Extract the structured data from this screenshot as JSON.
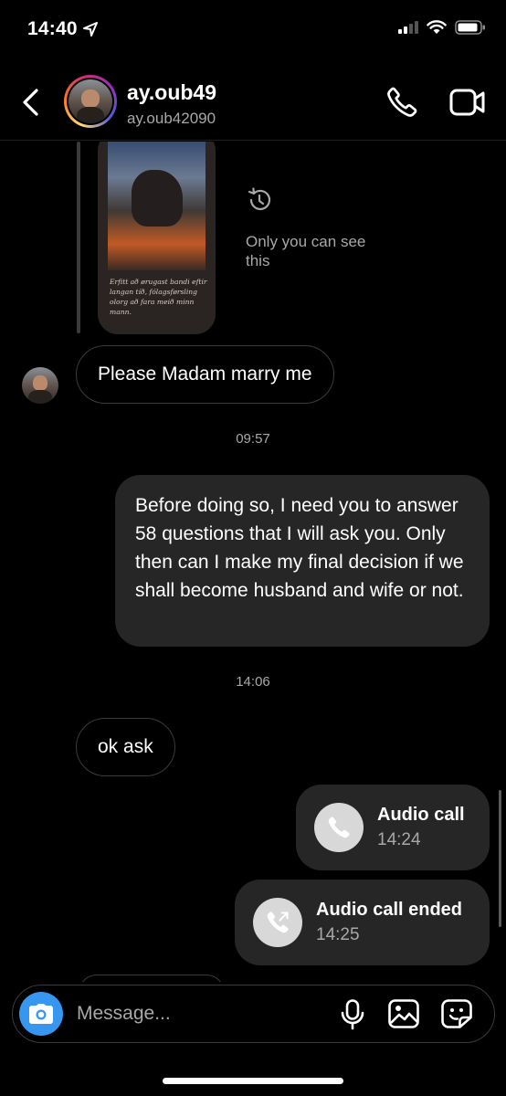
{
  "status_bar": {
    "time": "14:40"
  },
  "header": {
    "username": "ay.oub49",
    "subname": "ay.oub42090"
  },
  "story_reply": {
    "caption": "Erfitt að ørugast bandi eftir langan tíð, fólagsførsling olorg að fara meið minn mann.",
    "notice": "Only you can see this"
  },
  "messages": [
    {
      "direction": "in",
      "text": "Please Madam marry me"
    },
    {
      "type": "timestamp",
      "text": "09:57"
    },
    {
      "direction": "out",
      "text": "Before doing so, I need you to answer 58 questions that I will ask you. Only then can I make my final decision if we shall become husband and wife or not."
    },
    {
      "type": "timestamp",
      "text": "14:06"
    },
    {
      "direction": "in",
      "text": "ok ask"
    },
    {
      "direction": "out",
      "type": "call",
      "title": "Audio call",
      "time": "14:24",
      "icon": "phone-icon"
    },
    {
      "direction": "out",
      "type": "call",
      "title": "Audio call ended",
      "time": "14:25",
      "icon": "call-ended-icon"
    }
  ],
  "composer": {
    "placeholder": "Message..."
  },
  "colors": {
    "accent": "#3797f0",
    "bubble_out": "#262626",
    "muted": "#a8a8a8"
  }
}
